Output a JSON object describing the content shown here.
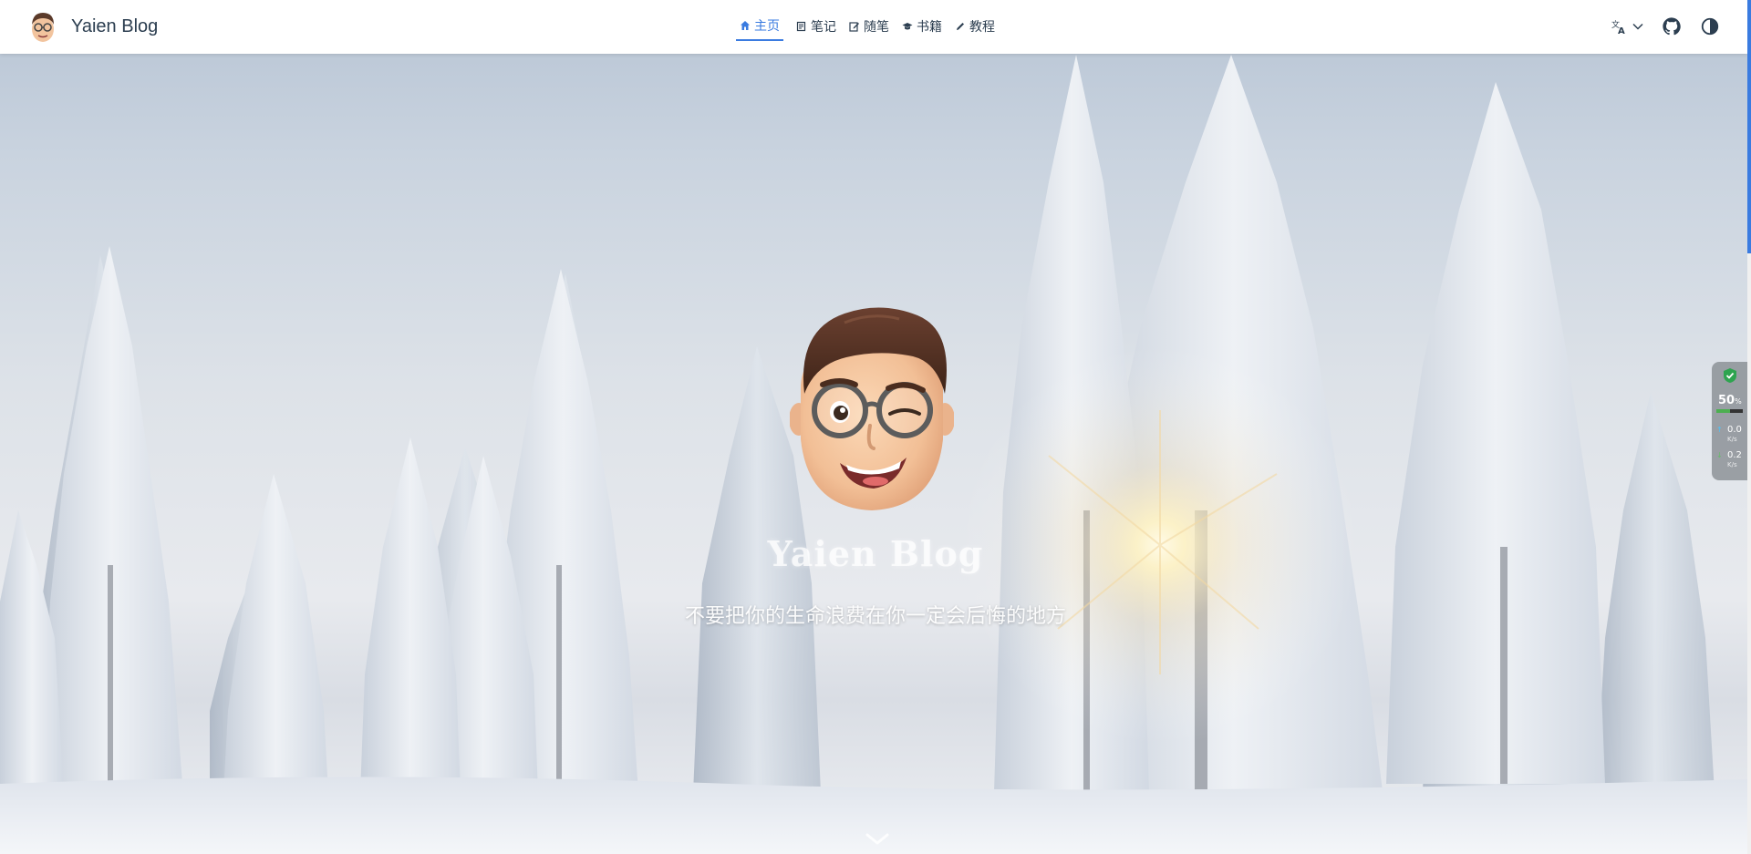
{
  "brand": {
    "title": "Yaien Blog"
  },
  "nav": {
    "items": [
      {
        "label": "主页",
        "icon": "home-icon",
        "active": true
      },
      {
        "label": "笔记",
        "icon": "notes-icon",
        "active": false
      },
      {
        "label": "随笔",
        "icon": "edit-icon",
        "active": false
      },
      {
        "label": "书籍",
        "icon": "graduation-cap-icon",
        "active": false
      },
      {
        "label": "教程",
        "icon": "pencil-icon",
        "active": false
      }
    ],
    "right_icons": [
      "translate-icon",
      "github-icon",
      "theme-toggle-icon"
    ]
  },
  "hero": {
    "title": "Yaien Blog",
    "subtitle": "不要把你的生命浪费在你一定会后悔的地方"
  },
  "system_widget": {
    "cpu_value": "50",
    "cpu_unit": "%",
    "cpu_level": 0.5,
    "upload_value": "0.0",
    "upload_unit": "K/s",
    "download_value": "0.2",
    "download_unit": "K/s"
  },
  "colors": {
    "accent": "#3a7be0",
    "nav_text": "#2c3e50"
  }
}
